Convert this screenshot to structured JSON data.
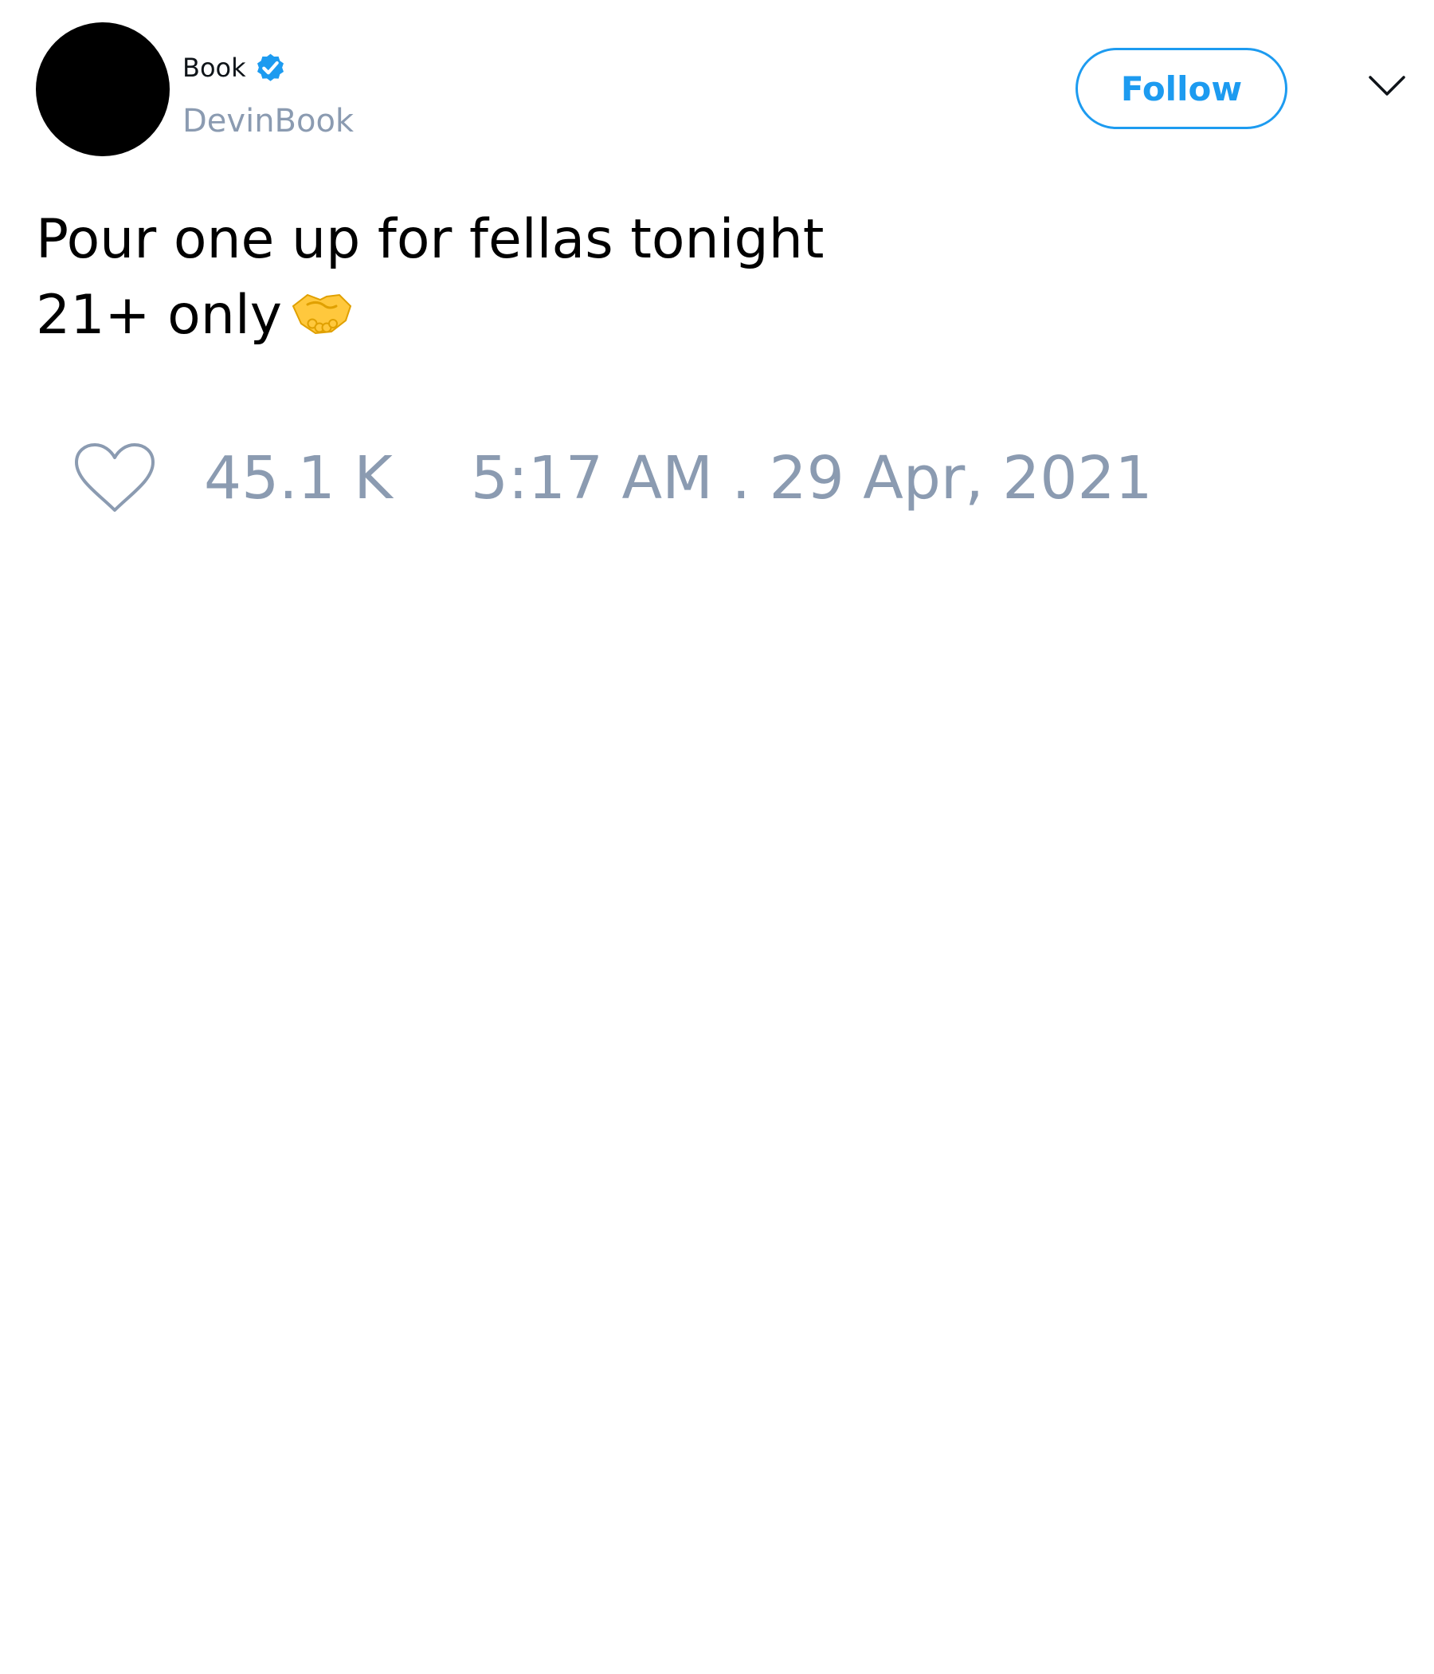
{
  "author": {
    "display_name": "Book",
    "handle": "DevinBook",
    "verified": true,
    "avatar_color": "#000000"
  },
  "follow_button": {
    "label": "Follow",
    "color": "#1d9bf0"
  },
  "menu": {
    "icon": "chevron-down-icon"
  },
  "tweet": {
    "text_line1": "Pour one up for fellas tonight",
    "text_line2": "21+ only",
    "emoji": "handshake-emoji"
  },
  "footer": {
    "like_icon": "heart-icon",
    "like_count": "45.1 K",
    "timestamp": "5:17 AM . 29 Apr, 2021",
    "meta_color": "#8b9bb1"
  }
}
